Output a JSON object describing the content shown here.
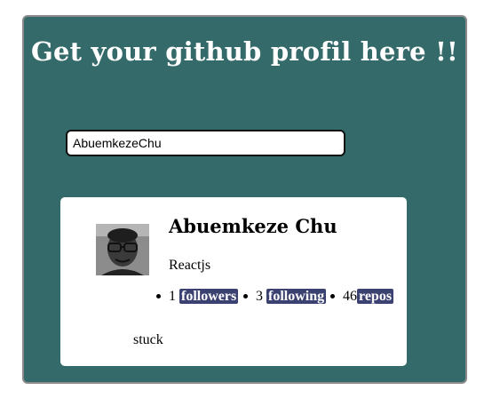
{
  "header": {
    "title": "Get your github profil here !!"
  },
  "search": {
    "value": "AbuemkezeChu"
  },
  "profile": {
    "name": "Abuemkeze Chu",
    "bio": "Reactjs",
    "avatar_icon": "user-avatar-photo",
    "stats": [
      {
        "value": "1",
        "label": "followers"
      },
      {
        "value": "3",
        "label": "following"
      },
      {
        "value": "46",
        "label": "repos"
      }
    ],
    "location": "stuck"
  },
  "colors": {
    "panel": "#346b6a",
    "badge": "#3b4170"
  }
}
